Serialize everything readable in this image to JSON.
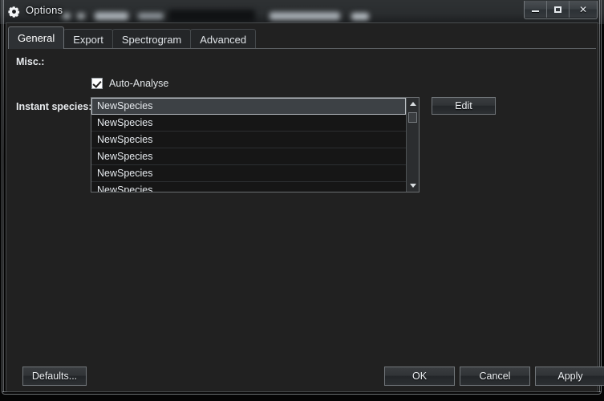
{
  "window": {
    "title": "Options",
    "icon": "gear-icon",
    "controls": [
      {
        "name": "minimize",
        "glyph": "–"
      },
      {
        "name": "maximize",
        "glyph": "□"
      },
      {
        "name": "close",
        "glyph": "✕"
      }
    ]
  },
  "tabs": [
    {
      "label": "General",
      "active": true
    },
    {
      "label": "Export",
      "active": false
    },
    {
      "label": "Spectrogram",
      "active": false
    },
    {
      "label": "Advanced",
      "active": false
    }
  ],
  "general": {
    "misc_label": "Misc.:",
    "auto_analyse": {
      "label": "Auto-Analyse",
      "checked": true
    },
    "instant_species_label": "Instant species:",
    "species_list": [
      {
        "name": "NewSpecies",
        "selected": true
      },
      {
        "name": "NewSpecies",
        "selected": false
      },
      {
        "name": "NewSpecies",
        "selected": false
      },
      {
        "name": "NewSpecies",
        "selected": false
      },
      {
        "name": "NewSpecies",
        "selected": false
      },
      {
        "name": "NewSpecies",
        "selected": false
      }
    ],
    "edit_button": "Edit"
  },
  "footer": {
    "defaults": "Defaults...",
    "ok": "OK",
    "cancel": "Cancel",
    "apply": "Apply"
  },
  "colors": {
    "window_bg": "#212121",
    "list_bg": "#161616",
    "selection": "#3d4145",
    "text": "#e6eaee",
    "border": "#6a6e71"
  }
}
